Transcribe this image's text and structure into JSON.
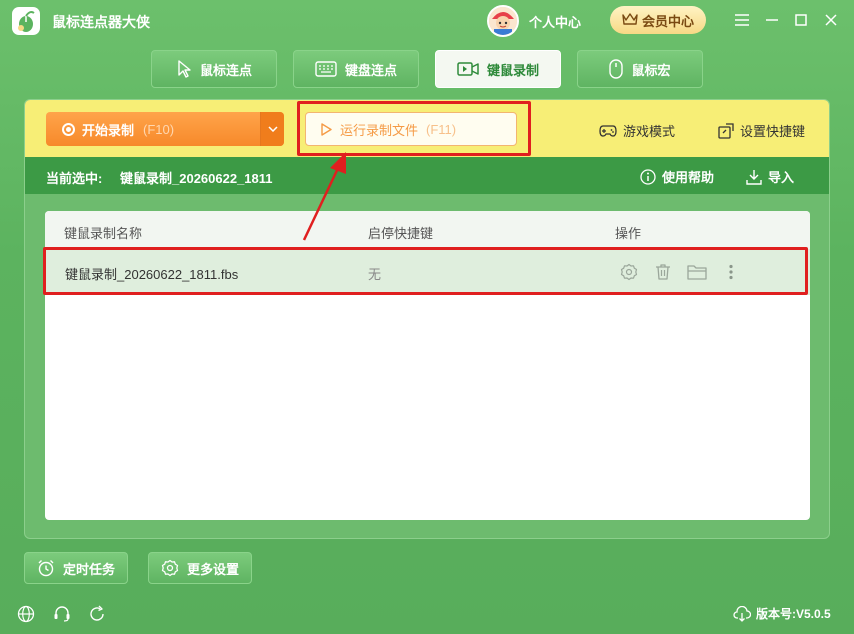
{
  "app": {
    "title": "鼠标连点器大侠",
    "user_center": "个人中心",
    "vip_center": "会员中心"
  },
  "tabs": [
    {
      "label": "鼠标连点",
      "icon": "cursor-icon"
    },
    {
      "label": "键盘连点",
      "icon": "keyboard-icon"
    },
    {
      "label": "键鼠录制",
      "icon": "video-icon",
      "active": true
    },
    {
      "label": "鼠标宏",
      "icon": "mouse-icon"
    }
  ],
  "toolbar": {
    "record_label": "开始录制",
    "record_hotkey": "(F10)",
    "run_label": "运行录制文件",
    "run_hotkey": "(F11)",
    "game_mode": "游戏模式",
    "set_hotkey": "设置快捷键"
  },
  "subbar": {
    "current_label": "当前选中:",
    "current_value": "键鼠录制_20260622_1811",
    "help": "使用帮助",
    "import": "导入"
  },
  "table": {
    "headers": [
      "键鼠录制名称",
      "启停快捷键",
      "操作"
    ],
    "rows": [
      {
        "name": "键鼠录制_20260622_1811.fbs",
        "hotkey": "无"
      }
    ]
  },
  "bottom": {
    "scheduled": "定时任务",
    "more_settings": "更多设置",
    "version_label": "版本号:",
    "version": "V5.0.5"
  },
  "colors": {
    "accent_green": "#3c9a45",
    "toolbar_yellow": "#f7ee76",
    "record_orange": "#f7892a",
    "highlight_red": "#e01f1f"
  }
}
